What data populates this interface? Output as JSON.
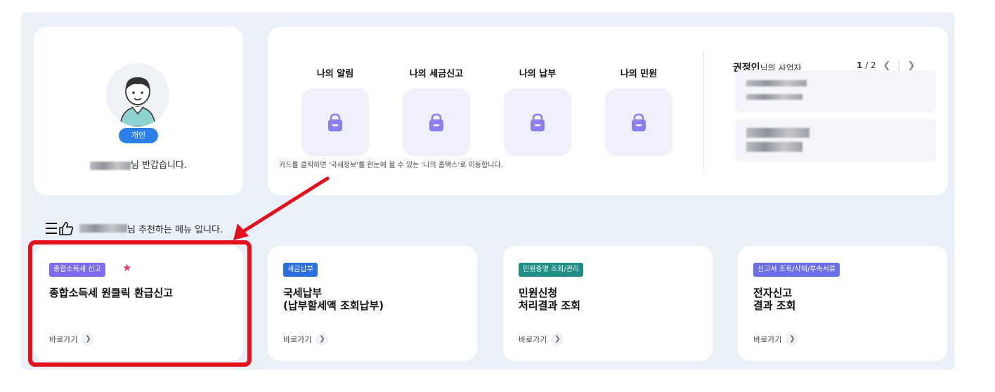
{
  "profile": {
    "badge": "개인",
    "greeting_suffix": "님 반갑습니다."
  },
  "summary": {
    "items": [
      {
        "label": "나의 알림"
      },
      {
        "label": "나의 세금신고"
      },
      {
        "label": "나의 납부"
      },
      {
        "label": "나의 민원"
      }
    ],
    "note": "카드를 클릭하면 '국세정보'를 한눈에 볼 수 있는 '나의 홈택스'로 이동합니다.",
    "business": {
      "name": "권정인",
      "suffix": "님의 사업자",
      "page_current": "1",
      "page_total": "/ 2"
    }
  },
  "recommend": {
    "suffix": "님 추천하는 메뉴 입니다."
  },
  "menus": [
    {
      "tag": "종합소득세 신고",
      "tag_color": "#7c6cf0",
      "title": "종합소득세 원클릭 환급신고",
      "goto": "바로가기",
      "starred": true
    },
    {
      "tag": "세금납부",
      "tag_color": "#2a6fe0",
      "title": "국세납부\n(납부할세액 조회납부)",
      "goto": "바로가기",
      "starred": false
    },
    {
      "tag": "민원증명 조회/관리",
      "tag_color": "#1e8e86",
      "title": "민원신청\n처리결과 조회",
      "goto": "바로가기",
      "starred": false
    },
    {
      "tag": "신고서 조회/삭제/부속서류",
      "tag_color": "#6a6ee8",
      "title": "전자신고\n결과 조회",
      "goto": "바로가기",
      "starred": false
    }
  ],
  "colors": {
    "highlight": "#e4101b",
    "background": "#e9f0f8"
  }
}
